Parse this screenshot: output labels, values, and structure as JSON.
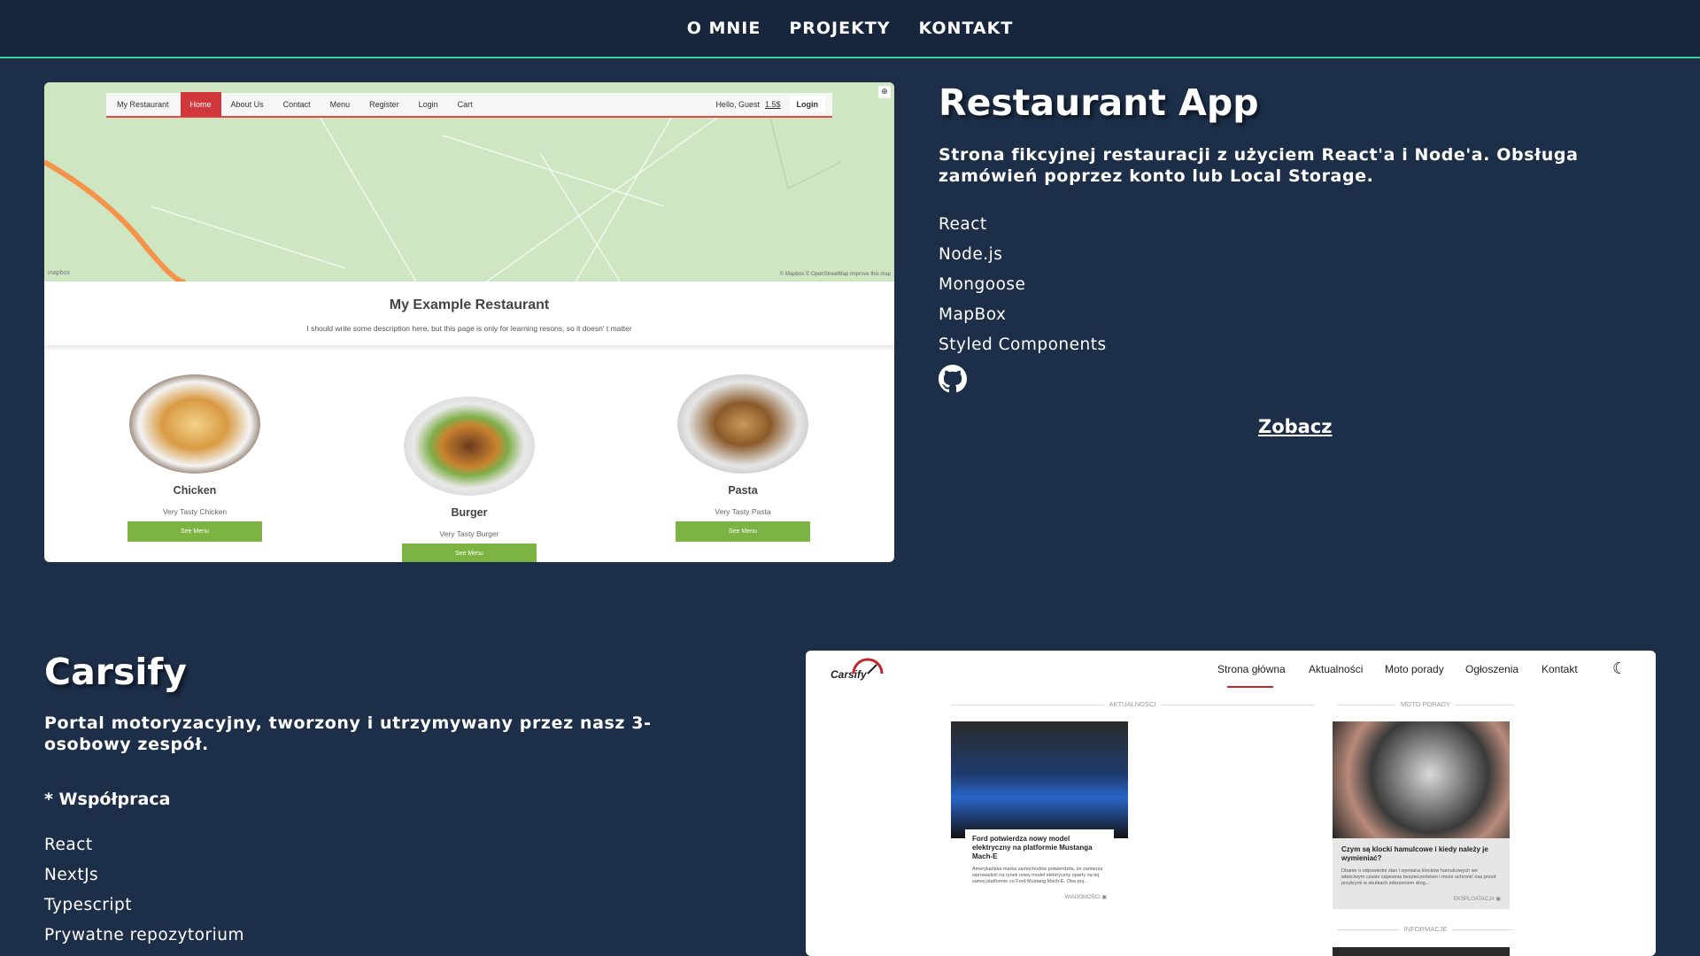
{
  "nav": {
    "items": [
      "O MNIE",
      "PROJEKTY",
      "KONTAKT"
    ]
  },
  "restaurant": {
    "title": "Restaurant App",
    "description": "Strona fikcyjnej restauracji z użyciem React'a i Node'a. Obsługa zamówień poprzez konto lub Local Storage.",
    "tech": [
      "React",
      "Node.js",
      "Mongoose",
      "MapBox",
      "Styled Components"
    ],
    "icon": "github-icon",
    "link_label": "Zobacz",
    "screenshot": {
      "nav": [
        "My Restaurant",
        "Home",
        "About Us",
        "Contact",
        "Menu",
        "Register",
        "Login",
        "Cart"
      ],
      "greeting": "Hello, Guest",
      "cart_amount": "1.5$",
      "login_button": "Login",
      "map_credits": "© Mapbox © OpenStreetMap  Improve this map",
      "map_logo": "mapbox",
      "hero_title": "My Example Restaurant",
      "hero_text": "I should write some description here, but this page is only for learning resons, so it doesn' t matter",
      "dishes": [
        {
          "name": "Chicken",
          "desc": "Very Tasty Chicken",
          "button": "See Menu"
        },
        {
          "name": "Burger",
          "desc": "Very Tasty Burger",
          "button": "See Menu"
        },
        {
          "name": "Pasta",
          "desc": "Very Tasty Pasta",
          "button": "See Menu"
        }
      ]
    }
  },
  "carsify": {
    "title": "Carsify",
    "description": "Portal motoryzacyjny, tworzony i utrzymywany przez nasz 3-osobowy zespół.",
    "collab": "* Współpraca",
    "tech": [
      "React",
      "NextJs",
      "Typescript",
      "Prywatne repozytorium"
    ],
    "screenshot": {
      "logo": "Carsify",
      "nav": [
        "Strona główna",
        "Aktualności",
        "Moto porady",
        "Ogłoszenia",
        "Kontakt"
      ],
      "theme_icon": "moon-icon",
      "sections": [
        "AKTUALNOŚCI",
        "MOTO PORADY",
        "INFORMACJE"
      ],
      "cards": [
        {
          "title": "Ford potwierdza nowy model elektryczny na platformie Mustanga Mach-E",
          "body": "Amerykańska marka samochodów potwierdziła, że zamierza wprowadzić na rynek nowy model elektryczny oparty na tej samej platformie co Ford Mustang Mach-E. Oba poj...",
          "tag": "WIADOMOŚCI"
        },
        {
          "title": "Czym są klocki hamulcowe i kiedy należy je wymieniać?",
          "body": "Dbanie o odpowiedni stan i wymiana klocków hamulcowych we właściwym czasie zapewnia bezpieczeństwo i może uchronić nas przed przykrymi w skutkach zdarzeniem drog...",
          "tag": "EKSPLOATACJA"
        }
      ]
    }
  },
  "colors": {
    "background": "#1c2e48",
    "nav_border": "#3fd0a0",
    "accent_red": "#d0383b",
    "button_green": "#7cb342"
  }
}
